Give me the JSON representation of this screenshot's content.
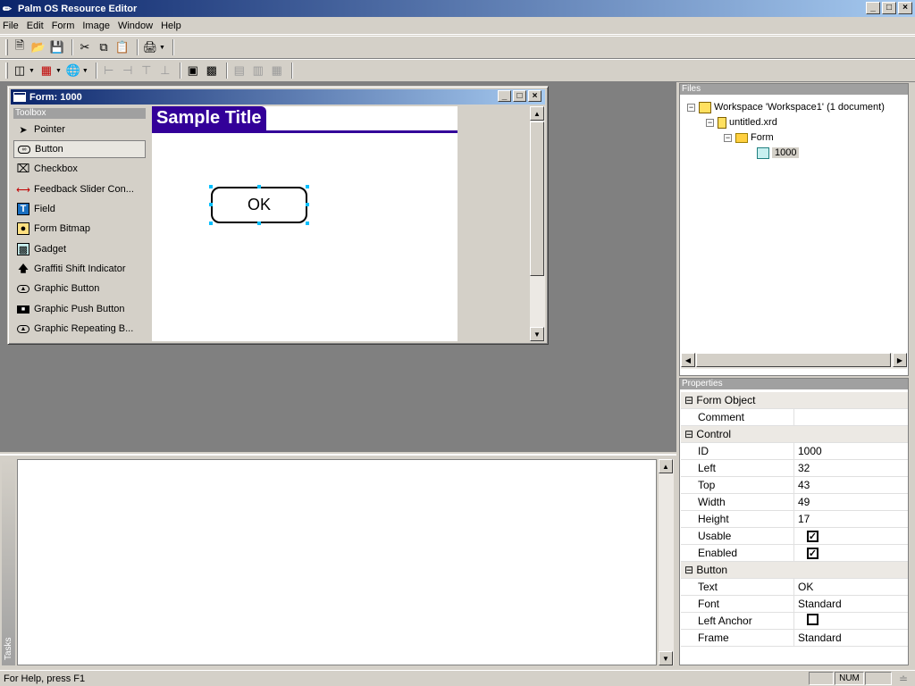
{
  "app": {
    "title": "Palm OS Resource Editor"
  },
  "menu": [
    "File",
    "Edit",
    "Form",
    "Image",
    "Window",
    "Help"
  ],
  "form_window": {
    "title": "Form: 1000"
  },
  "toolbox": {
    "label": "Toolbox",
    "items": [
      {
        "label": "Pointer",
        "icon": "pointer-icon"
      },
      {
        "label": "Button",
        "icon": "button-icon"
      },
      {
        "label": "Checkbox",
        "icon": "checkbox-icon"
      },
      {
        "label": "Feedback Slider Con...",
        "icon": "slider-icon"
      },
      {
        "label": "Field",
        "icon": "field-icon"
      },
      {
        "label": "Form Bitmap",
        "icon": "bitmap-icon"
      },
      {
        "label": "Gadget",
        "icon": "gadget-icon"
      },
      {
        "label": "Graffiti Shift Indicator",
        "icon": "arrow-up-icon"
      },
      {
        "label": "Graphic Button",
        "icon": "graphic-button-icon"
      },
      {
        "label": "Graphic Push Button",
        "icon": "push-button-icon"
      },
      {
        "label": "Graphic Repeating B...",
        "icon": "repeating-button-icon"
      }
    ],
    "selected": 1
  },
  "canvas": {
    "form_title": "Sample Title",
    "button_text": "OK"
  },
  "tasks": {
    "label": "Tasks"
  },
  "files": {
    "label": "Files",
    "tree": [
      {
        "label": "Workspace 'Workspace1' (1 document)",
        "level": 0
      },
      {
        "label": "untitled.xrd",
        "level": 1
      },
      {
        "label": "Form",
        "level": 2
      },
      {
        "label": "1000",
        "level": 3
      }
    ]
  },
  "properties": {
    "label": "Properties",
    "rows": [
      {
        "name": "Form Object",
        "cat": true
      },
      {
        "name": "Comment",
        "value": ""
      },
      {
        "name": "Control",
        "cat": true
      },
      {
        "name": "ID",
        "value": "1000"
      },
      {
        "name": "Left",
        "value": "32"
      },
      {
        "name": "Top",
        "value": "43"
      },
      {
        "name": "Width",
        "value": "49"
      },
      {
        "name": "Height",
        "value": "17"
      },
      {
        "name": "Usable",
        "check": true
      },
      {
        "name": "Enabled",
        "check": true
      },
      {
        "name": "Button",
        "cat": true
      },
      {
        "name": "Text",
        "value": "OK"
      },
      {
        "name": "Font",
        "value": "Standard"
      },
      {
        "name": "Left Anchor",
        "check": false
      },
      {
        "name": "Frame",
        "value": "Standard"
      }
    ]
  },
  "status": {
    "text": "For Help, press F1",
    "num": "NUM"
  }
}
